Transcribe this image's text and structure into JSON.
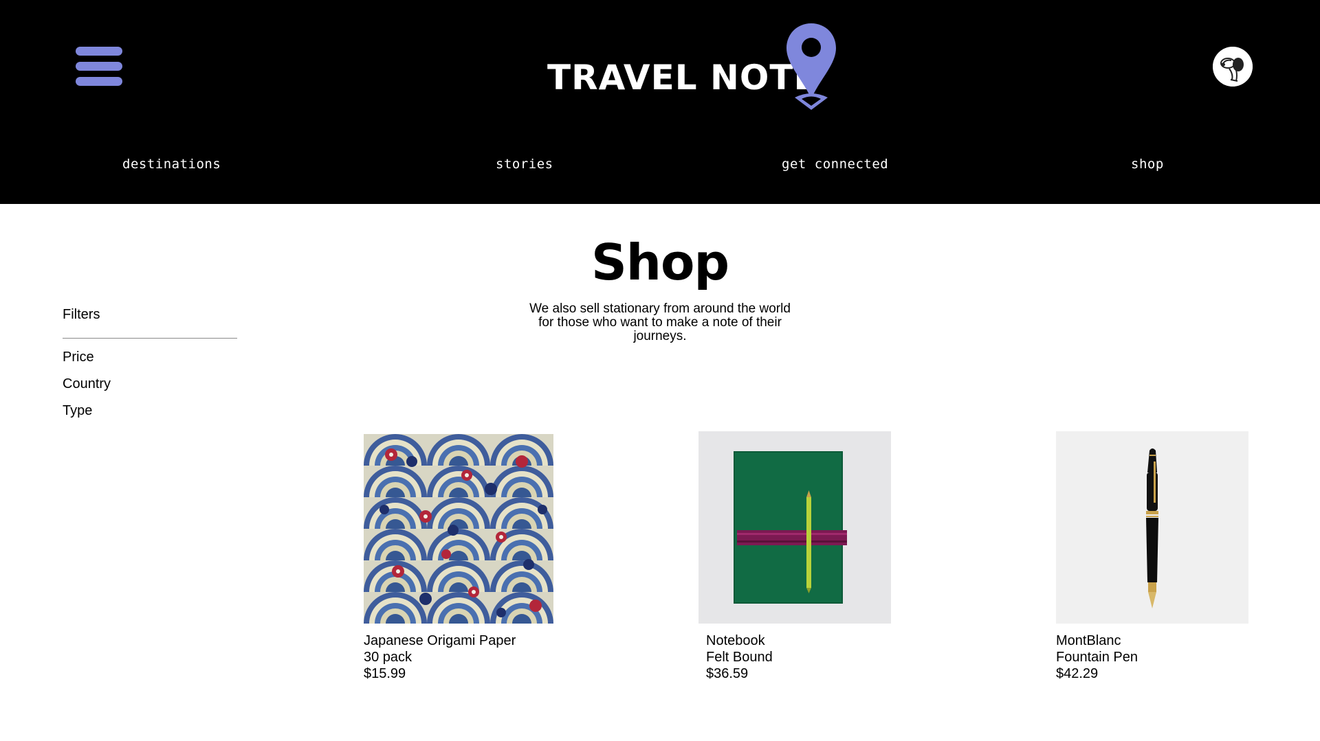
{
  "header": {
    "logo_text": "TRAVEL NOTE",
    "accent_color": "#7f87dc",
    "menu_icon": "hamburger-menu-icon",
    "pin_icon": "map-pin-icon",
    "avatar_icon": "snoopy-avatar"
  },
  "nav": {
    "items": [
      {
        "label": "destinations"
      },
      {
        "label": "stories"
      },
      {
        "label": "get connected"
      },
      {
        "label": "shop"
      }
    ]
  },
  "main": {
    "title": "Shop",
    "intro_lines": [
      "We also sell stationary from around the world",
      "for those who want to make a note of their",
      "journeys."
    ]
  },
  "filters": {
    "title": "Filters",
    "items": [
      {
        "label": "Price"
      },
      {
        "label": "Country"
      },
      {
        "label": "Type"
      }
    ]
  },
  "products": [
    {
      "name": "Japanese Origami Paper",
      "detail": "30 pack",
      "price": "$15.99",
      "image": "origami-paper-image"
    },
    {
      "name": "Notebook",
      "detail": "Felt Bound",
      "price": "$36.59",
      "image": "green-notebook-image"
    },
    {
      "name": "MontBlanc",
      "detail": "Fountain Pen",
      "price": "$42.29",
      "image": "fountain-pen-image"
    }
  ]
}
